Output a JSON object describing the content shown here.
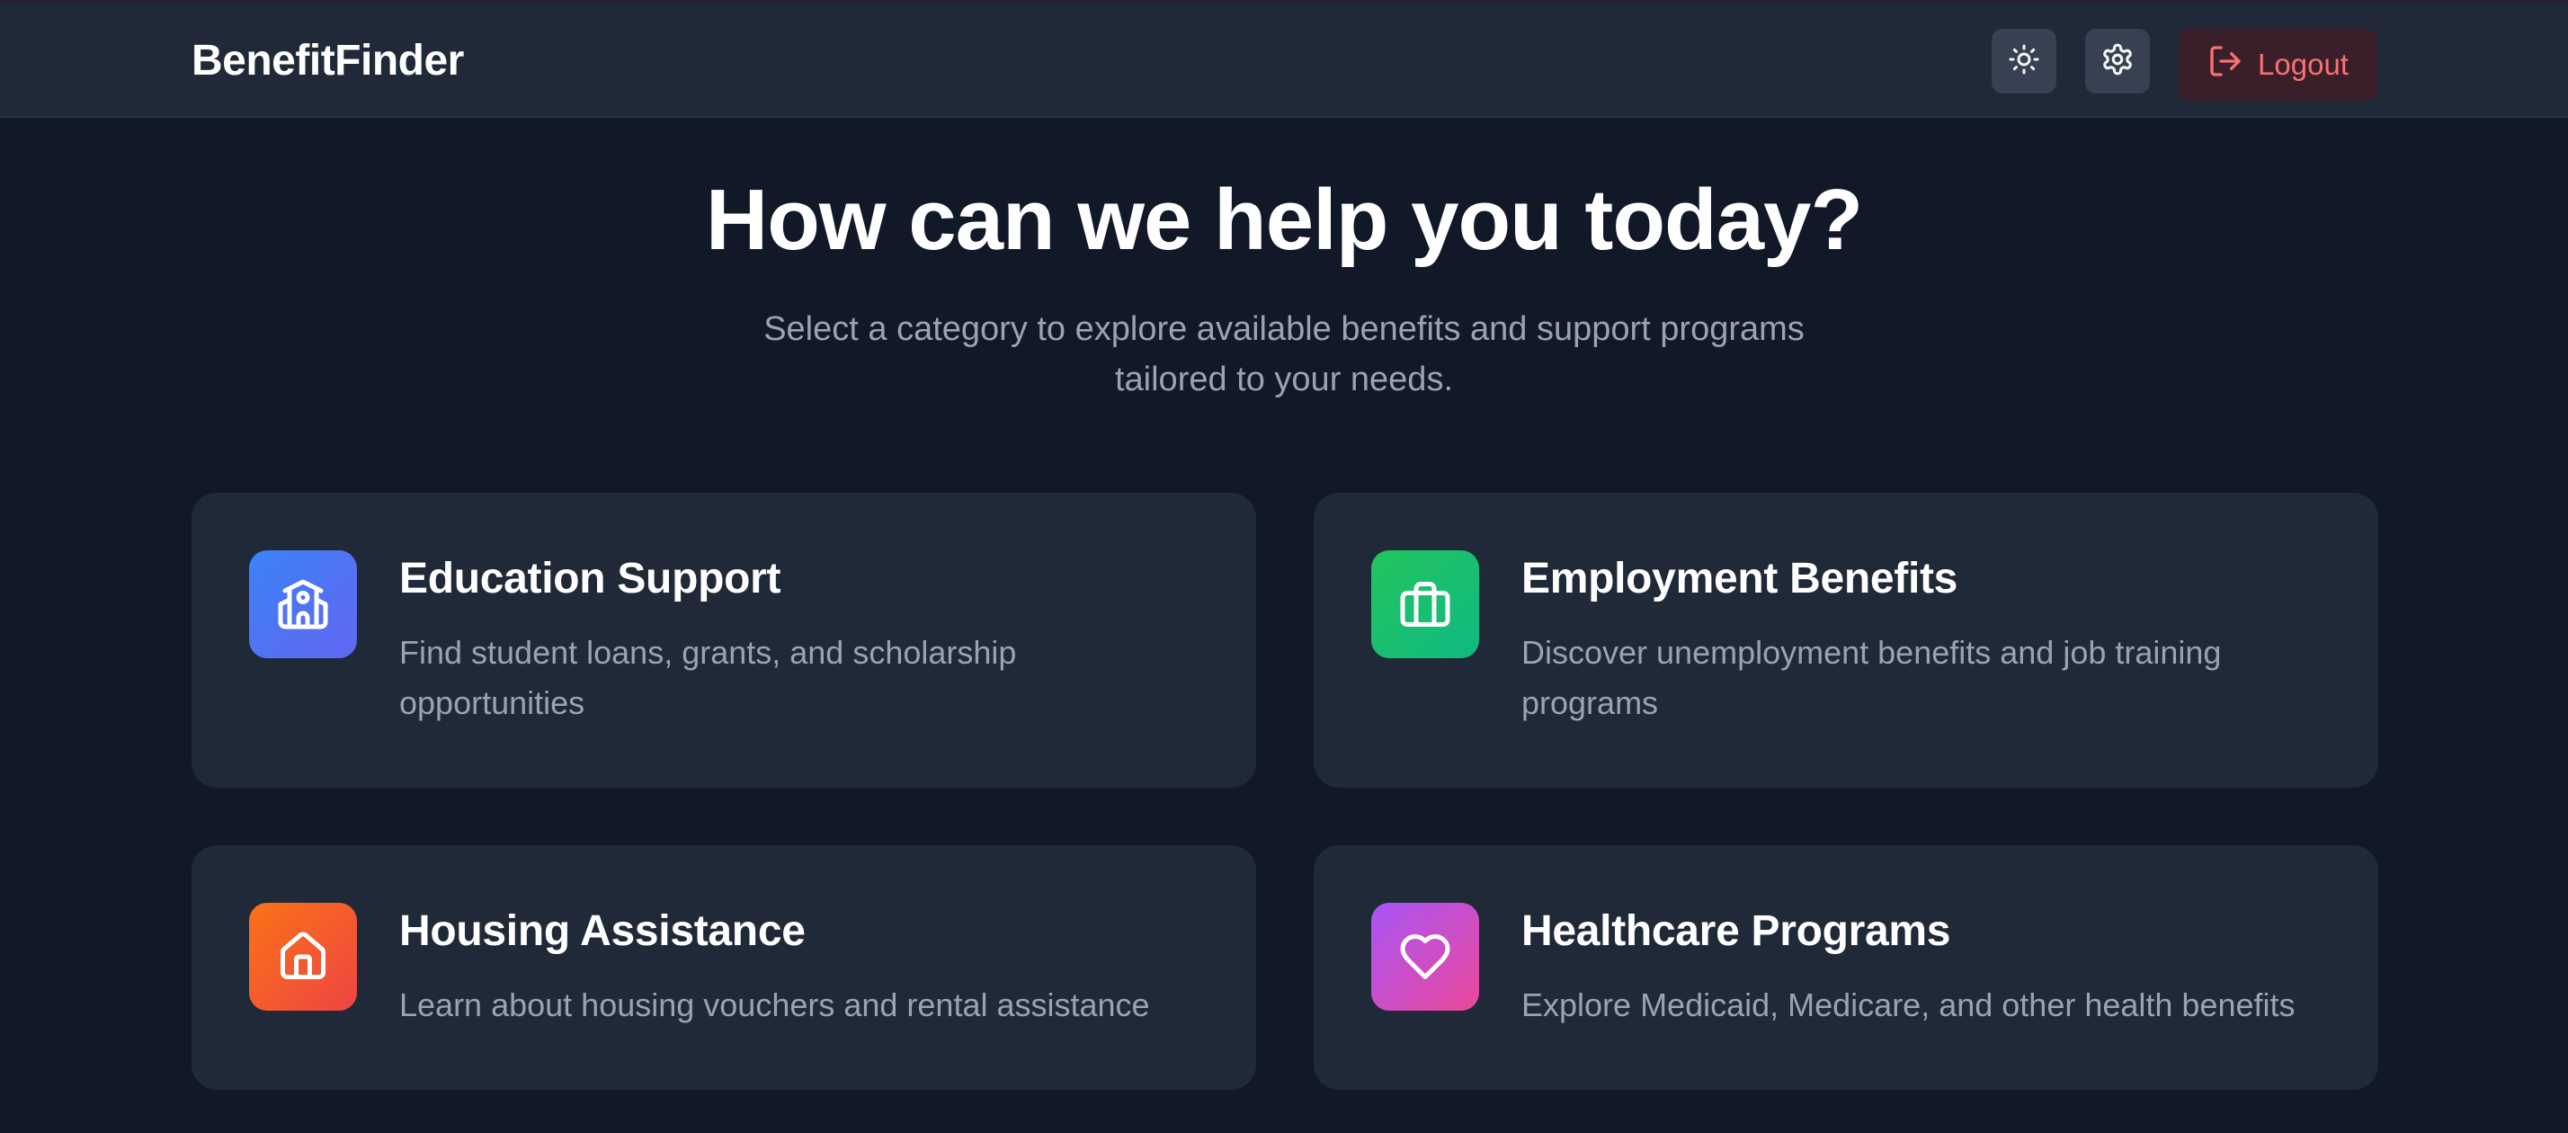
{
  "app": {
    "brand": "BenefitFinder"
  },
  "header": {
    "theme_icon": "sun-icon",
    "settings_icon": "gear-icon",
    "logout_icon": "logout-icon",
    "logout_label": "Logout"
  },
  "hero": {
    "title": "How can we help you today?",
    "subtitle": "Select a category to explore available benefits and support programs tailored to your needs."
  },
  "categories": [
    {
      "title": "Education Support",
      "description": "Find student loans, grants, and scholarship opportunities",
      "icon": "school-icon",
      "color_from": "#3b82f6",
      "color_to": "#6366f1"
    },
    {
      "title": "Employment Benefits",
      "description": "Discover unemployment benefits and job training programs",
      "icon": "briefcase-icon",
      "color_from": "#22c55e",
      "color_to": "#10b981"
    },
    {
      "title": "Housing Assistance",
      "description": "Learn about housing vouchers and rental assistance",
      "icon": "home-icon",
      "color_from": "#f97316",
      "color_to": "#ef4444"
    },
    {
      "title": "Healthcare Programs",
      "description": "Explore Medicaid, Medicare, and other health benefits",
      "icon": "heart-icon",
      "color_from": "#a855f7",
      "color_to": "#ec4899"
    }
  ],
  "colors": {
    "background": "#111827",
    "surface": "#1f2937",
    "muted_text": "#9ca3af",
    "danger": "#f87171"
  }
}
